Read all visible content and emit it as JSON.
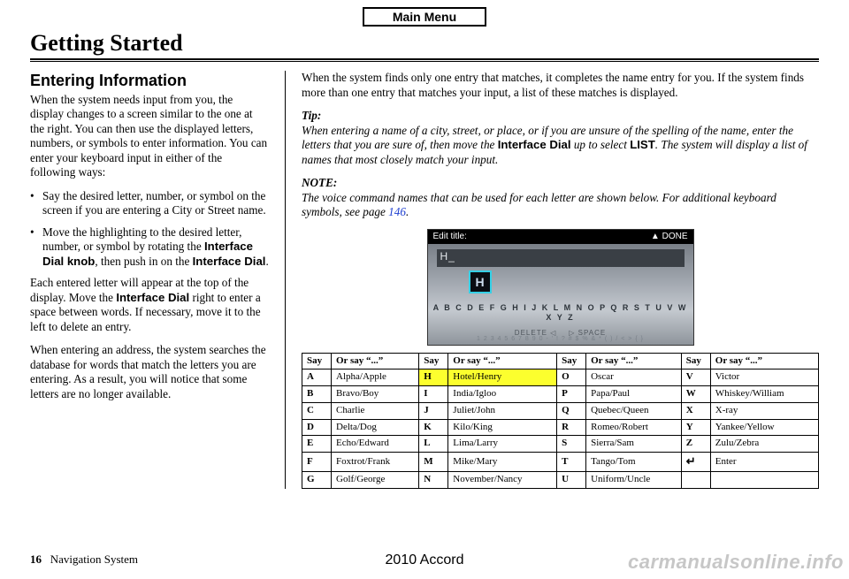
{
  "main_menu_label": "Main Menu",
  "section_title": "Getting Started",
  "left": {
    "sub_title": "Entering Information",
    "intro": "When the system needs input from you, the display changes to a screen similar to the one at the right. You can then use the displayed letters, numbers, or symbols to enter information. You can enter your keyboard input in either of the following ways:",
    "bullet1": "Say the desired letter, number, or symbol on the screen if you are entering a City or Street name.",
    "bullet2_a": "Move the highlighting to the desired letter, number, or symbol by rotating the ",
    "bullet2_b": "Interface Dial knob",
    "bullet2_c": ", then push in on the ",
    "bullet2_d": "Interface Dial",
    "bullet2_e": ".",
    "para2_a": "Each entered letter will appear at the top of the display. Move the ",
    "para2_b": "Interface Dial",
    "para2_c": " right to enter a space between words. If necessary, move it to the left to delete an entry.",
    "para3": "When entering an address, the system searches the database for words that match the letters you are entering. As a result, you will notice that some letters are no longer available."
  },
  "right": {
    "intro": "When the system finds only one entry that matches, it completes the name entry for you. If the system finds more than one entry that matches your input, a list of these matches is displayed.",
    "tip_head": "Tip:",
    "tip_a": "When entering a name of a city, street, or place, or if you are unsure of the spelling of the name, enter the letters that you are sure of, then move the ",
    "tip_b": "Interface Dial",
    "tip_c": " up to select ",
    "tip_d": "LIST",
    "tip_e": ". The system will display a list of names that most closely match your input.",
    "note_head": "NOTE:",
    "note_a": "The voice command names that can be used for each letter are shown below. For additional keyboard symbols, see page ",
    "note_link": "146",
    "note_b": "."
  },
  "nav_screen": {
    "title_left": "Edit title:",
    "title_right": "▲ DONE",
    "input_text": "H_",
    "highlight_letter": "H",
    "arc": "A B C D E F G H I J K L M N O P Q R S T U V W X Y Z",
    "delete": "DELETE ◁",
    "space": "▷ SPACE",
    "numrow": "1 2 3 4 5 6 7 8 9 0 - ' ! ? # $ % & * ( ) / < > { }"
  },
  "table_headers": {
    "say": "Say",
    "orsay": "Or say “...”"
  },
  "phonetic": [
    {
      "l": "A",
      "w": "Alpha/Apple",
      "l2": "H",
      "w2": "Hotel/Henry",
      "hl": true,
      "l3": "O",
      "w3": "Oscar",
      "l4": "V",
      "w4": "Victor"
    },
    {
      "l": "B",
      "w": "Bravo/Boy",
      "l2": "I",
      "w2": "India/Igloo",
      "l3": "P",
      "w3": "Papa/Paul",
      "l4": "W",
      "w4": "Whiskey/William"
    },
    {
      "l": "C",
      "w": "Charlie",
      "l2": "J",
      "w2": "Juliet/John",
      "l3": "Q",
      "w3": "Quebec/Queen",
      "l4": "X",
      "w4": "X-ray"
    },
    {
      "l": "D",
      "w": "Delta/Dog",
      "l2": "K",
      "w2": "Kilo/King",
      "l3": "R",
      "w3": "Romeo/Robert",
      "l4": "Y",
      "w4": "Yankee/Yellow"
    },
    {
      "l": "E",
      "w": "Echo/Edward",
      "l2": "L",
      "w2": "Lima/Larry",
      "l3": "S",
      "w3": "Sierra/Sam",
      "l4": "Z",
      "w4": "Zulu/Zebra"
    },
    {
      "l": "F",
      "w": "Foxtrot/Frank",
      "l2": "M",
      "w2": "Mike/Mary",
      "l3": "T",
      "w3": "Tango/Tom",
      "l4": "↵",
      "w4": "Enter",
      "enter": true
    },
    {
      "l": "G",
      "w": "Golf/George",
      "l2": "N",
      "w2": "November/Nancy",
      "l3": "U",
      "w3": "Uniform/Uncle",
      "l4": "",
      "w4": ""
    }
  ],
  "footer": {
    "page_num": "16",
    "page_label": "Navigation System",
    "model": "2010 Accord"
  },
  "watermark": "carmanualsonline.info"
}
